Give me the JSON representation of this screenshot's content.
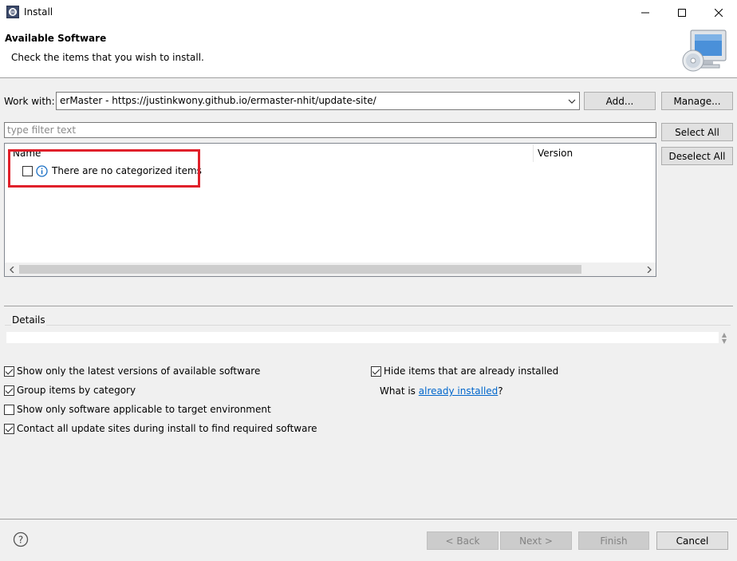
{
  "window": {
    "title": "Install"
  },
  "banner": {
    "title": "Available Software",
    "description": "Check the items that you wish to install."
  },
  "work_with": {
    "label": "Work with:",
    "value": "erMaster - https://justinkwony.github.io/ermaster-nhit/update-site/",
    "add_label": "Add...",
    "manage_label": "Manage..."
  },
  "filter": {
    "placeholder": "type filter text"
  },
  "selection": {
    "select_all_label": "Select All",
    "deselect_all_label": "Deselect All"
  },
  "tree": {
    "columns": [
      "Name",
      "Version"
    ],
    "rows": [
      {
        "label": "There are no categorized items",
        "checked": false,
        "icon": "info-icon"
      }
    ]
  },
  "details": {
    "label": "Details"
  },
  "options": {
    "show_latest": {
      "label": "Show only the latest versions of available software",
      "checked": true
    },
    "group_by_category": {
      "label": "Group items by category",
      "checked": true
    },
    "show_applicable": {
      "label": "Show only software applicable to target environment",
      "checked": false
    },
    "contact_sites": {
      "label": "Contact all update sites during install to find required software",
      "checked": true
    },
    "hide_installed": {
      "label": "Hide items that are already installed",
      "checked": true
    },
    "what_is": {
      "prefix": "What is ",
      "link": "already installed",
      "suffix": "?"
    }
  },
  "footer": {
    "back_label": "< Back",
    "next_label": "Next >",
    "finish_label": "Finish",
    "cancel_label": "Cancel"
  },
  "colors": {
    "highlight": "#e0202a",
    "link": "#0066cc",
    "info": "#1a6fc4"
  }
}
